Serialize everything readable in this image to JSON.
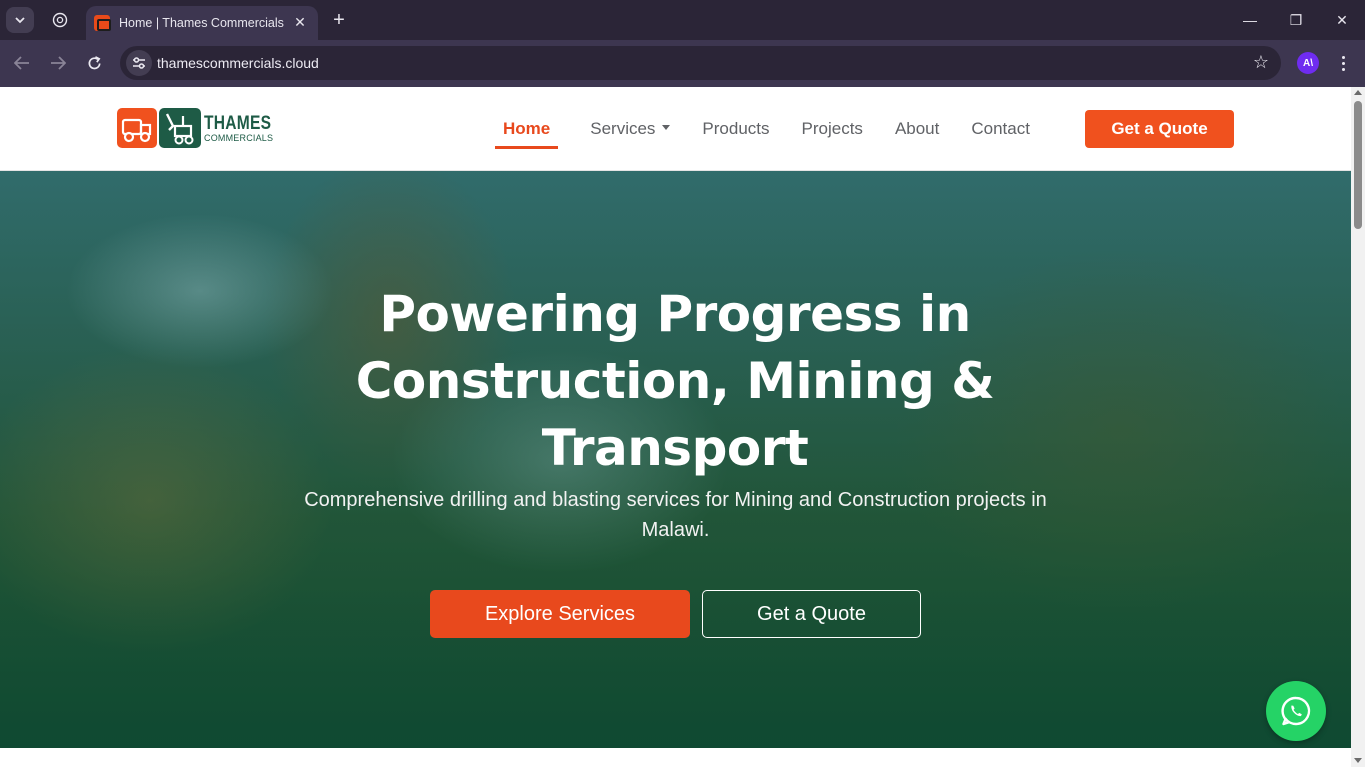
{
  "browser": {
    "tab_title": "Home | Thames Commercials",
    "tab_close": "✕",
    "new_tab": "+",
    "url": "thamescommercials.cloud",
    "profile_initial": "A\\",
    "window": {
      "minimize": "—",
      "restore": "❐",
      "close": "✕"
    }
  },
  "site": {
    "logo": {
      "name": "THAMES",
      "tagline": "COMMERCIALS"
    },
    "nav": [
      {
        "label": "Home",
        "active": true
      },
      {
        "label": "Services",
        "dropdown": true
      },
      {
        "label": "Products"
      },
      {
        "label": "Projects"
      },
      {
        "label": "About"
      },
      {
        "label": "Contact"
      }
    ],
    "header_cta": "Get a Quote",
    "hero": {
      "title": "Powering Progress in Construction, Mining & Transport",
      "subtitle": "Comprehensive drilling and blasting services for Mining and Construction projects in Malawi.",
      "primary_cta": "Explore Services",
      "secondary_cta": "Get a Quote"
    },
    "floating": {
      "icon": "whatsapp-icon"
    }
  },
  "colors": {
    "accent": "#e8491d",
    "brand_green": "#1e5b46",
    "whatsapp": "#25d366",
    "browser_frame": "#2b2537"
  }
}
